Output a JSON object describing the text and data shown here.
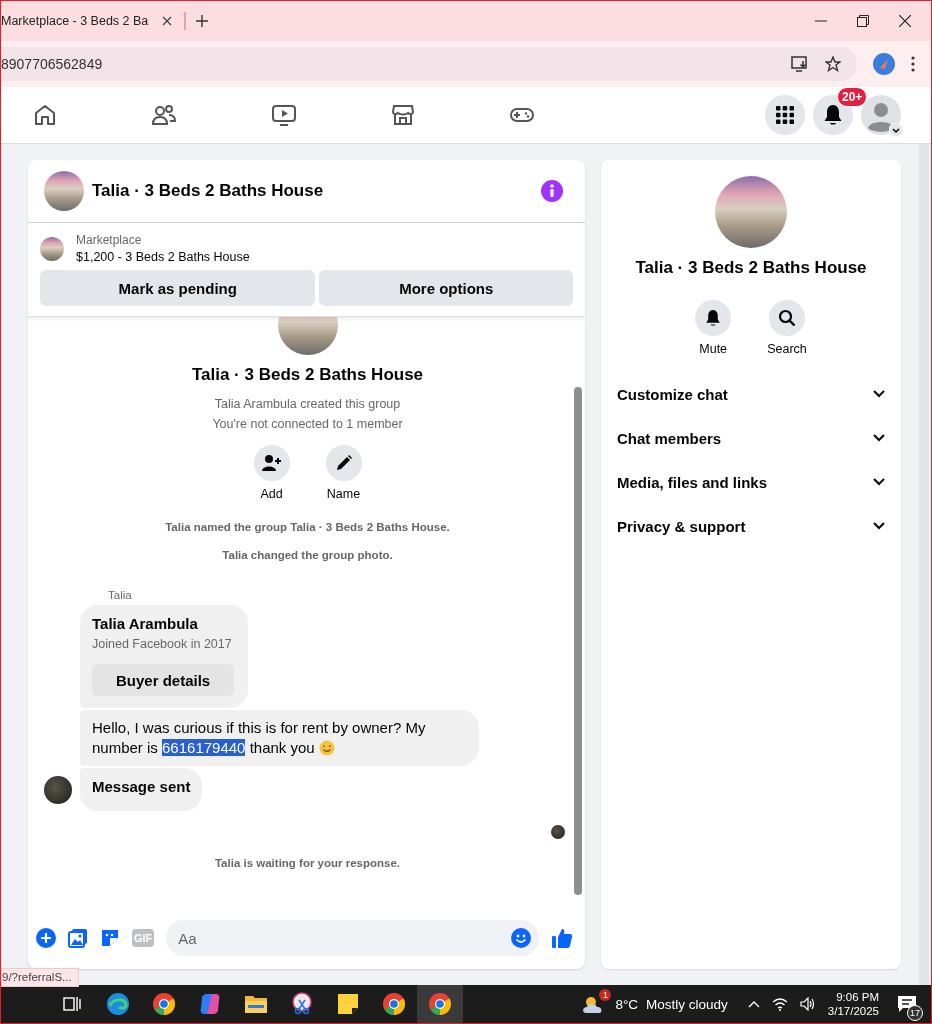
{
  "browser": {
    "tab_title": "Marketplace - 3 Beds 2 Ba",
    "url": "8907706562849"
  },
  "nav": {
    "notification_badge": "20+"
  },
  "chat": {
    "title": "Talia · 3 Beds 2 Baths House",
    "listing": {
      "label": "Marketplace",
      "title": "$1,200 - 3 Beds 2 Baths House"
    },
    "buttons": [
      "Mark as pending",
      "More options"
    ],
    "group": {
      "name": "Talia · 3 Beds 2 Baths House",
      "created": "Talia Arambula created this group",
      "connection": "You're not connected to 1 member",
      "actions": [
        {
          "kind": "add",
          "label": "Add"
        },
        {
          "kind": "name",
          "label": "Name"
        }
      ]
    },
    "events": [
      "Talia named the group Talia · 3 Beds 2 Baths House.",
      "Talia changed the group photo."
    ],
    "sender": "Talia",
    "card": {
      "name": "Talia Arambula",
      "joined": "Joined Facebook in 2017",
      "button": "Buyer details"
    },
    "message": {
      "before": "Hello, I was curious if this is for rent by owner? My number is",
      "highlighted": "6616179440",
      "after": "thank you"
    },
    "sent": "Message sent",
    "waiting": "Talia is waiting for your response.",
    "composer": {
      "placeholder": "Aa",
      "gif": "GIF"
    }
  },
  "details": {
    "title": "Talia · 3 Beds 2 Baths House",
    "actions": [
      {
        "kind": "mute",
        "label": "Mute"
      },
      {
        "kind": "search",
        "label": "Search"
      }
    ],
    "sections": [
      {
        "label": "Customize chat",
        "expanded": false
      },
      {
        "label": "Chat members",
        "expanded": false
      },
      {
        "label": "Media, files and links",
        "expanded": false
      },
      {
        "label": "Privacy & support",
        "expanded": false
      }
    ]
  },
  "status_url": "9/?referralS...",
  "taskbar": {
    "apps": [
      {
        "kind": "task-view",
        "selected": false
      },
      {
        "kind": "edge",
        "selected": false
      },
      {
        "kind": "chrome",
        "selected": false
      },
      {
        "kind": "copilot",
        "selected": false
      },
      {
        "kind": "files",
        "selected": false
      },
      {
        "kind": "snip",
        "selected": false
      },
      {
        "kind": "notes",
        "selected": false
      },
      {
        "kind": "chrome",
        "selected": false
      },
      {
        "kind": "chrome",
        "selected": true
      }
    ],
    "weather_badge": "1",
    "temperature": "8°C",
    "weather": "Mostly cloudy",
    "time": "9:06 PM",
    "date": "3/17/2025",
    "notification_count": "17"
  }
}
